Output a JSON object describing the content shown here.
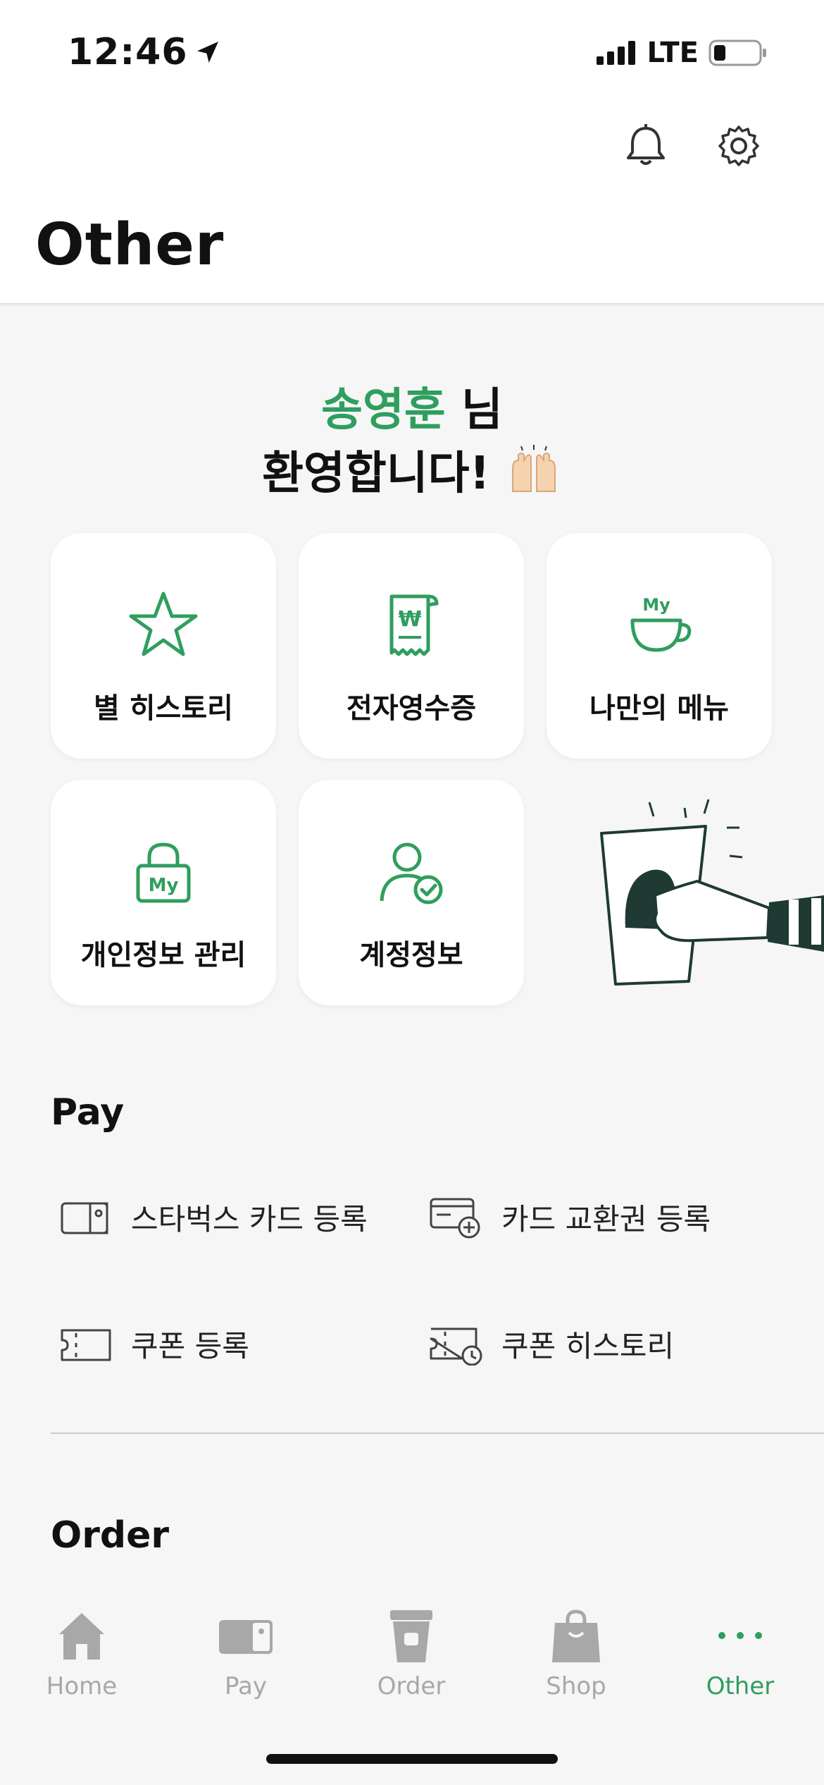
{
  "status_bar": {
    "time": "12:46",
    "network": "LTE"
  },
  "header": {
    "title": "Other"
  },
  "welcome": {
    "name": "송영훈",
    "suffix": " 님",
    "line2": "환영합니다!",
    "emoji": "🙌"
  },
  "tiles": [
    {
      "label": "별 히스토리",
      "icon": "star-icon"
    },
    {
      "label": "전자영수증",
      "icon": "receipt-icon"
    },
    {
      "label": "나만의 메뉴",
      "icon": "my-cup-icon"
    },
    {
      "label": "개인정보 관리",
      "icon": "my-lock-icon"
    },
    {
      "label": "계정정보",
      "icon": "account-check-icon"
    }
  ],
  "cup_icon_text": "My",
  "pay": {
    "title": "Pay",
    "items": [
      {
        "label": "스타벅스 카드 등록",
        "icon": "card-icon"
      },
      {
        "label": "카드 교환권 등록",
        "icon": "card-add-icon"
      },
      {
        "label": "쿠폰 등록",
        "icon": "coupon-icon"
      },
      {
        "label": "쿠폰 히스토리",
        "icon": "coupon-history-icon"
      }
    ]
  },
  "order": {
    "title": "Order"
  },
  "tabbar": {
    "items": [
      {
        "label": "Home",
        "icon": "home-icon"
      },
      {
        "label": "Pay",
        "icon": "pay-card-icon"
      },
      {
        "label": "Order",
        "icon": "cup-icon"
      },
      {
        "label": "Shop",
        "icon": "bag-icon"
      },
      {
        "label": "Other",
        "icon": "more-dots-icon",
        "active": true
      }
    ]
  },
  "colors": {
    "accent": "#2f9e5e",
    "inactive": "#a8a8a8",
    "background": "#f6f6f6"
  }
}
